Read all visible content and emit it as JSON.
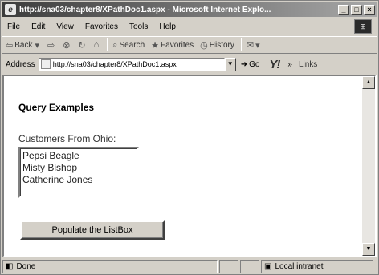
{
  "window": {
    "title": "http://sna03/chapter8/XPathDoc1.aspx - Microsoft Internet Explo..."
  },
  "menu": [
    "File",
    "Edit",
    "View",
    "Favorites",
    "Tools",
    "Help"
  ],
  "toolbar": {
    "back_label": "Back",
    "search_label": "Search",
    "favorites_label": "Favorites",
    "history_label": "History"
  },
  "address": {
    "label": "Address",
    "url": "http://sna03/chapter8/XPathDoc1.aspx",
    "go_label": "Go",
    "links_label": "Links"
  },
  "page": {
    "heading": "Query Examples",
    "list_label": "Customers From Ohio:",
    "list_items": [
      "Pepsi Beagle",
      "Misty Bishop",
      "Catherine Jones"
    ],
    "button_label": "Populate the ListBox"
  },
  "status": {
    "text": "Done",
    "zone": "Local intranet"
  },
  "icons": {
    "ie": "internet-explorer-icon",
    "throbber": "windows-logo-icon"
  }
}
